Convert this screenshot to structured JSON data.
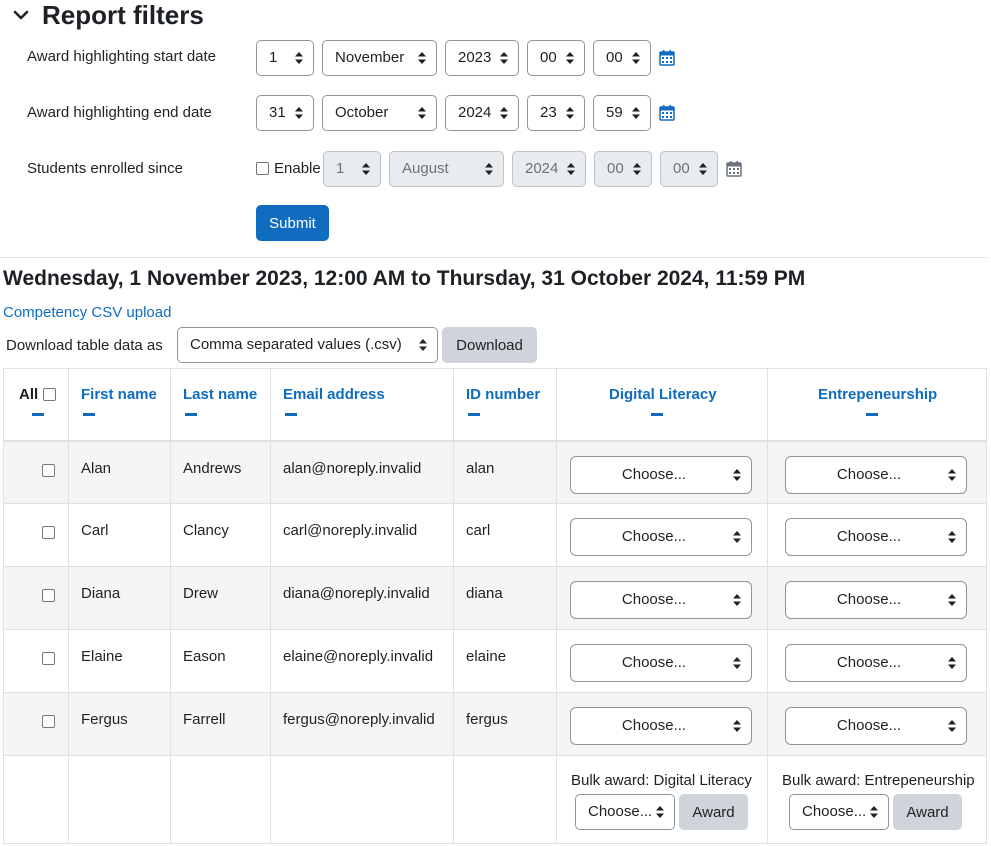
{
  "filters": {
    "title": "Report filters",
    "rows": [
      {
        "label": "Award highlighting start date",
        "day": "1",
        "month": "November",
        "year": "2023",
        "hour": "00",
        "minute": "00"
      },
      {
        "label": "Award highlighting end date",
        "day": "31",
        "month": "October",
        "year": "2024",
        "hour": "23",
        "minute": "59"
      },
      {
        "label": "Students enrolled since",
        "enable_label": "Enable",
        "day": "1",
        "month": "August",
        "year": "2024",
        "hour": "00",
        "minute": "00"
      }
    ],
    "submit_label": "Submit"
  },
  "range_title": "Wednesday, 1 November 2023, 12:00 AM to Thursday, 31 October 2024, 11:59 PM",
  "csv_upload_link": "Competency CSV upload",
  "download": {
    "label": "Download table data as",
    "format": "Comma separated values (.csv)",
    "button": "Download"
  },
  "table": {
    "headers": {
      "all": "All",
      "first_name": "First name",
      "last_name": "Last name",
      "email": "Email address",
      "id_number": "ID number",
      "competency1": "Digital Literacy",
      "competency2": "Entrepeneurship"
    },
    "rows": [
      {
        "first": "Alan",
        "last": "Andrews",
        "email": "alan@noreply.invalid",
        "id": "alan"
      },
      {
        "first": "Carl",
        "last": "Clancy",
        "email": "carl@noreply.invalid",
        "id": "carl"
      },
      {
        "first": "Diana",
        "last": "Drew",
        "email": "diana@noreply.invalid",
        "id": "diana"
      },
      {
        "first": "Elaine",
        "last": "Eason",
        "email": "elaine@noreply.invalid",
        "id": "elaine"
      },
      {
        "first": "Fergus",
        "last": "Farrell",
        "email": "fergus@noreply.invalid",
        "id": "fergus"
      }
    ],
    "choose_label": "Choose...",
    "bulk": {
      "label1": "Bulk award: Digital Literacy",
      "label2": "Bulk award: Entrepeneurship",
      "choose_label": "Choose...",
      "award_label": "Award"
    }
  },
  "colors": {
    "primary": "#0f6cbf",
    "secondary_button": "#ced4da",
    "stripe": "#f5f5f5"
  },
  "icons": {
    "collapse": "chevron-down-icon",
    "calendar": "calendar-icon",
    "select_arrows": "updown-arrows-icon"
  }
}
